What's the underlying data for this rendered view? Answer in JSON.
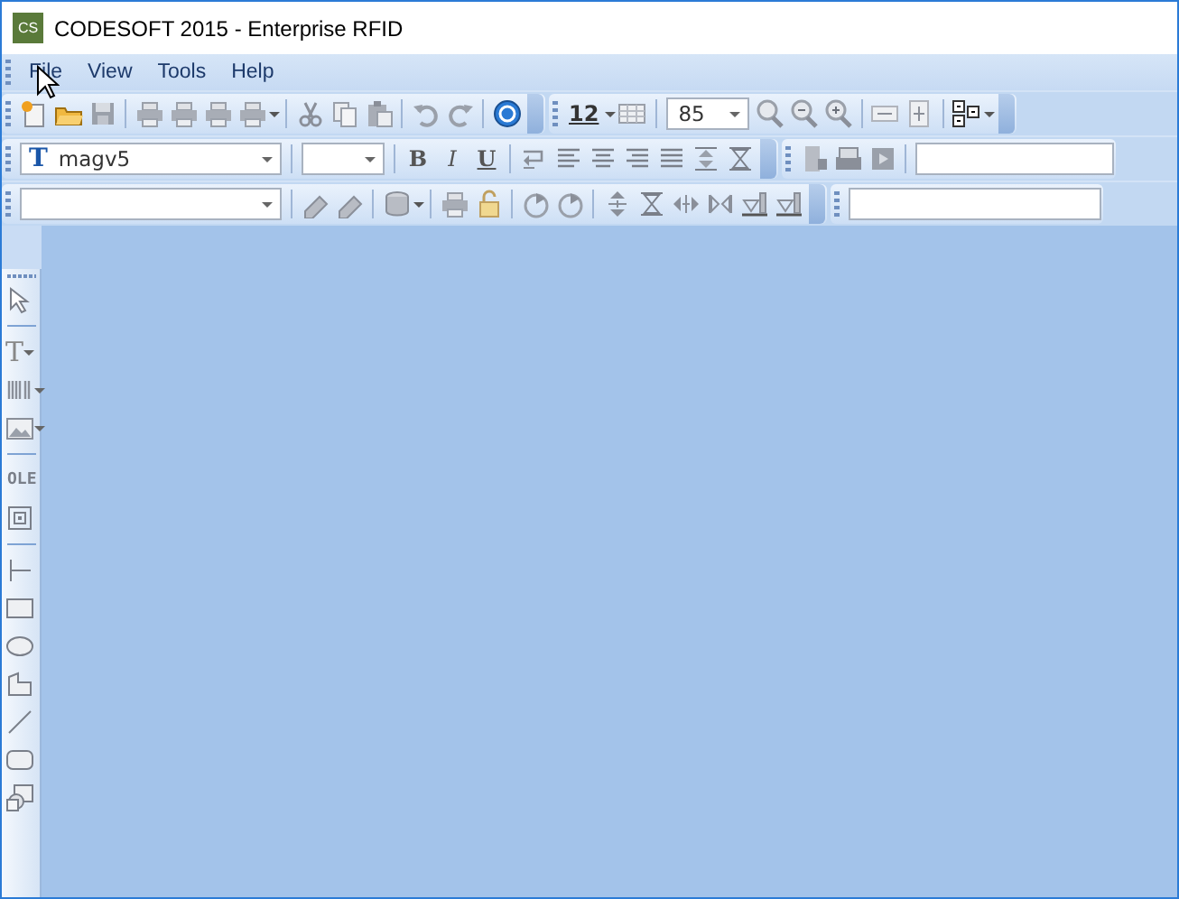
{
  "window": {
    "title": "CODESOFT 2015 - Enterprise RFID",
    "app_badge": "CS"
  },
  "menu": [
    {
      "label": "File"
    },
    {
      "label": "View"
    },
    {
      "label": "Tools"
    },
    {
      "label": "Help"
    }
  ],
  "toolbars": {
    "font_size_picker": "12",
    "zoom": "85",
    "font": "magv5",
    "font_glyph": "T",
    "format_buttons": [
      "B",
      "I",
      "U"
    ]
  },
  "tools": {
    "text_glyph": "T",
    "ole": "OLE"
  }
}
